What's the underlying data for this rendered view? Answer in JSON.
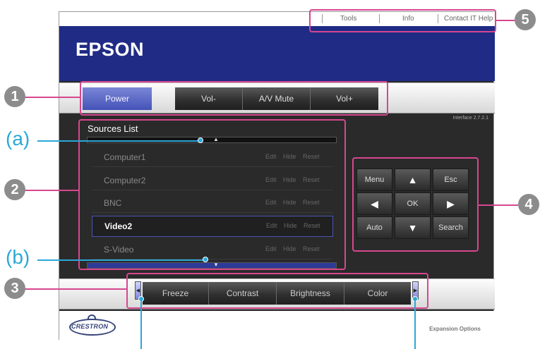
{
  "header": {
    "links": [
      "Tools",
      "Info",
      "Contact IT Help"
    ],
    "logo": "EPSON"
  },
  "control_bar": {
    "power_label": "Power",
    "vol_down_label": "Vol-",
    "av_mute_label": "A/V Mute",
    "vol_up_label": "Vol+"
  },
  "version": "Interface 2.7.2.1",
  "sources": {
    "title": "Sources List",
    "items": [
      {
        "name": "Computer1",
        "edit": "Edit",
        "hide": "Hide",
        "reset": "Reset"
      },
      {
        "name": "Computer2",
        "edit": "Edit",
        "hide": "Hide",
        "reset": "Reset"
      },
      {
        "name": "BNC",
        "edit": "Edit",
        "hide": "Hide",
        "reset": "Reset"
      },
      {
        "name": "Video2",
        "edit": "Edit",
        "hide": "Hide",
        "reset": "Reset"
      },
      {
        "name": "S-Video",
        "edit": "Edit",
        "hide": "Hide",
        "reset": "Reset"
      }
    ],
    "selected": "Video2",
    "scroll_up_glyph": "▲",
    "scroll_down_glyph": "▼"
  },
  "nav": {
    "menu": "Menu",
    "up": "▲",
    "esc": "Esc",
    "left": "◀",
    "ok": "OK",
    "right": "▶",
    "auto": "Auto",
    "down": "▼",
    "search": "Search"
  },
  "image_bar": {
    "freeze": "Freeze",
    "contrast": "Contrast",
    "brightness": "Brightness",
    "color": "Color",
    "scroll_left": "◀",
    "scroll_right": "▶"
  },
  "footer": {
    "crestron": "CRESTRON",
    "expansion": "Expansion Options"
  },
  "callouts": {
    "numbers": [
      "1",
      "2",
      "3",
      "4",
      "5"
    ],
    "letters": [
      "(a)",
      "(b)"
    ]
  },
  "colors": {
    "banner": "#1f2b85",
    "highlight": "#d6478f",
    "callout_line": "#2aa8d8",
    "power_button": "#5563c4"
  }
}
